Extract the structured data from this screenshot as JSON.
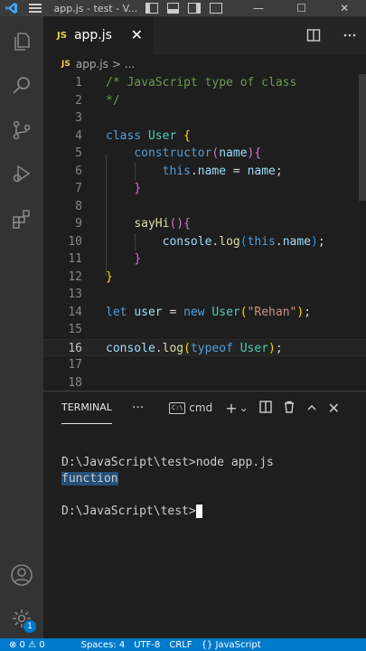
{
  "window": {
    "title": "app.js - test - V...",
    "controls": {
      "minimize": "—",
      "maximize": "☐",
      "close": "✕"
    }
  },
  "tab": {
    "badge": "JS",
    "label": "app.js",
    "close": "✕"
  },
  "breadcrumb": {
    "badge": "JS",
    "file": "app.js",
    "sep": ">",
    "more": "..."
  },
  "code": {
    "lines": [
      {
        "n": "1",
        "tokens": [
          [
            "comment",
            "/* JavaScript type of class"
          ]
        ]
      },
      {
        "n": "2",
        "tokens": [
          [
            "comment",
            "*/"
          ]
        ]
      },
      {
        "n": "3",
        "tokens": []
      },
      {
        "n": "4",
        "tokens": [
          [
            "kw",
            "class"
          ],
          [
            "plain",
            " "
          ],
          [
            "class",
            "User"
          ],
          [
            "plain",
            " "
          ],
          [
            "b1",
            "{"
          ]
        ]
      },
      {
        "n": "5",
        "tokens": [
          [
            "plain",
            "    "
          ],
          [
            "kw",
            "constructor"
          ],
          [
            "b2",
            "("
          ],
          [
            "var",
            "name"
          ],
          [
            "b2",
            ")"
          ],
          [
            "b2",
            "{"
          ]
        ]
      },
      {
        "n": "6",
        "tokens": [
          [
            "plain",
            "        "
          ],
          [
            "kw",
            "this"
          ],
          [
            "plain",
            "."
          ],
          [
            "var",
            "name"
          ],
          [
            "plain",
            " = "
          ],
          [
            "var",
            "name"
          ],
          [
            "plain",
            ";"
          ]
        ]
      },
      {
        "n": "7",
        "tokens": [
          [
            "plain",
            "    "
          ],
          [
            "b2",
            "}"
          ]
        ]
      },
      {
        "n": "8",
        "tokens": []
      },
      {
        "n": "9",
        "tokens": [
          [
            "plain",
            "    "
          ],
          [
            "fn",
            "sayHi"
          ],
          [
            "b2",
            "()"
          ],
          [
            "b2",
            "{"
          ]
        ]
      },
      {
        "n": "10",
        "tokens": [
          [
            "plain",
            "        "
          ],
          [
            "var",
            "console"
          ],
          [
            "plain",
            "."
          ],
          [
            "fn",
            "log"
          ],
          [
            "b3",
            "("
          ],
          [
            "kw",
            "this"
          ],
          [
            "plain",
            "."
          ],
          [
            "var",
            "name"
          ],
          [
            "b3",
            ")"
          ],
          [
            "plain",
            ";"
          ]
        ]
      },
      {
        "n": "11",
        "tokens": [
          [
            "plain",
            "    "
          ],
          [
            "b2",
            "}"
          ]
        ]
      },
      {
        "n": "12",
        "tokens": [
          [
            "b1",
            "}"
          ]
        ]
      },
      {
        "n": "13",
        "tokens": []
      },
      {
        "n": "14",
        "tokens": [
          [
            "kw",
            "let"
          ],
          [
            "plain",
            " "
          ],
          [
            "var",
            "user"
          ],
          [
            "plain",
            " = "
          ],
          [
            "kw",
            "new"
          ],
          [
            "plain",
            " "
          ],
          [
            "class",
            "User"
          ],
          [
            "b1",
            "("
          ],
          [
            "str",
            "\"Rehan\""
          ],
          [
            "b1",
            ")"
          ],
          [
            "plain",
            ";"
          ]
        ]
      },
      {
        "n": "15",
        "tokens": []
      },
      {
        "n": "16",
        "tokens": [
          [
            "var",
            "console"
          ],
          [
            "plain",
            "."
          ],
          [
            "fn",
            "log"
          ],
          [
            "b1",
            "("
          ],
          [
            "kw",
            "typeof"
          ],
          [
            "plain",
            " "
          ],
          [
            "class",
            "User"
          ],
          [
            "b1",
            ")"
          ],
          [
            "plain",
            ";"
          ]
        ]
      },
      {
        "n": "17",
        "tokens": []
      },
      {
        "n": "18",
        "tokens": []
      }
    ],
    "current_line": "16"
  },
  "panel": {
    "tab": "TERMINAL",
    "more": "···",
    "terminal_icon": "C:\\",
    "terminal_name": "cmd",
    "add": "+",
    "dropdown": "⌄",
    "split": "◫",
    "trash": "🗑",
    "maximize": "^",
    "close": "✕"
  },
  "terminal": {
    "command_line": "D:\\JavaScript\\test>node app.js",
    "output": "function",
    "prompt": "D:\\JavaScript\\test>"
  },
  "status": {
    "errors": "⊗ 0 ⚠ 0",
    "spaces": "Spaces: 4",
    "encoding": "UTF-8",
    "eol": "CRLF",
    "language": "{} JavaScript",
    "notifications": "1"
  },
  "icons": {
    "explorer": "files-icon",
    "search": "search-icon",
    "scm": "source-control-icon",
    "debug": "run-debug-icon",
    "extensions": "extensions-icon",
    "account": "account-icon",
    "settings": "gear-icon"
  },
  "colors": {
    "background": "#1e1e1e",
    "activity_bar": "#333333",
    "status_bar": "#007acc",
    "keyword": "#569cd6",
    "class": "#4ec9b0",
    "string": "#ce9178",
    "comment": "#6a9955"
  }
}
